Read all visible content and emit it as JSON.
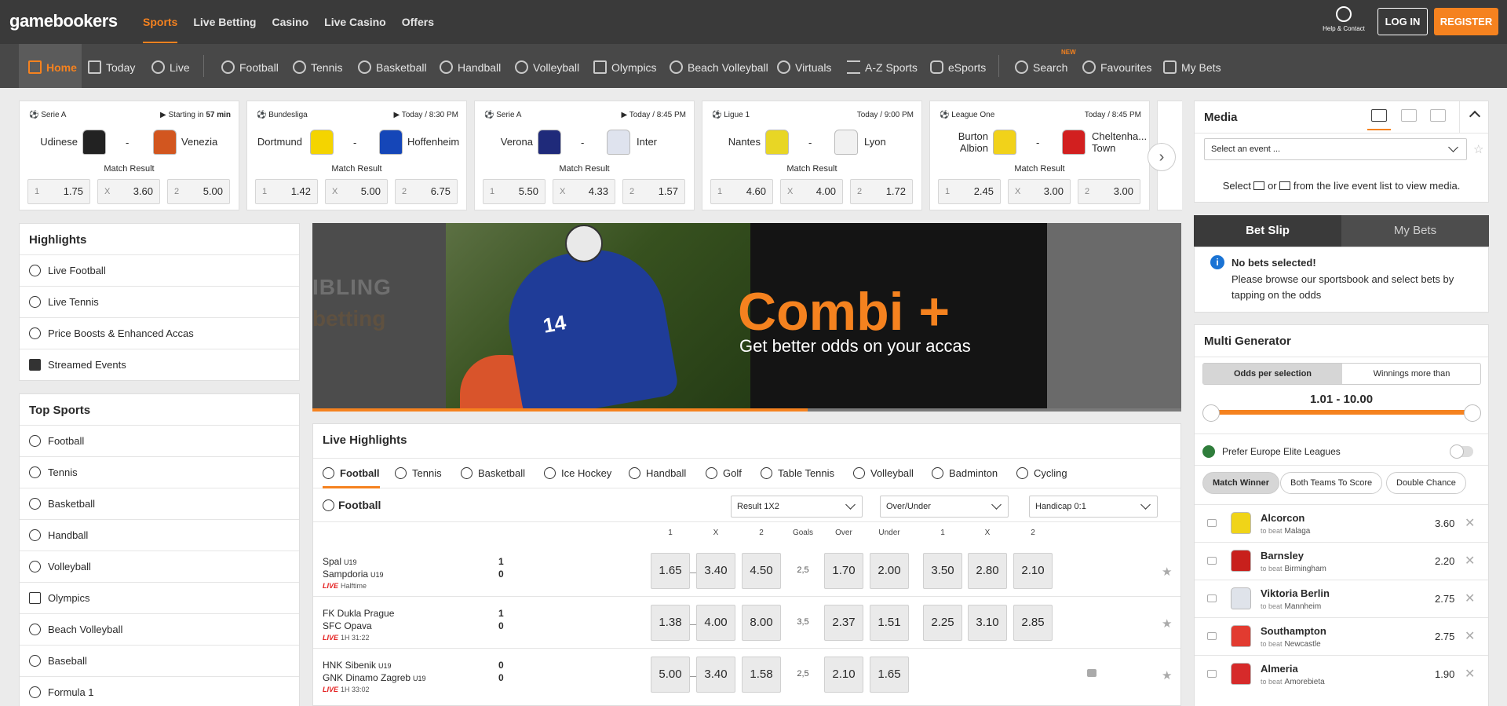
{
  "brand": "gamebookers",
  "top_nav": [
    "Sports",
    "Live Betting",
    "Casino",
    "Live Casino",
    "Offers"
  ],
  "help": "Help & Contact",
  "login": "LOG IN",
  "register": "REGISTER",
  "sub_nav": [
    "Home",
    "Today",
    "Live",
    "Football",
    "Tennis",
    "Basketball",
    "Handball",
    "Volleyball",
    "Olympics",
    "Beach Volleyball",
    "Virtuals",
    "A-Z Sports",
    "eSports",
    "Search",
    "Favourites",
    "My Bets"
  ],
  "new_badge": "NEW",
  "events": [
    {
      "league": "Serie A",
      "time_prefix": "Starting in",
      "time": "57 min",
      "home": "Udinese",
      "away": "Venezia",
      "market": "Match Result",
      "odds": [
        "1.75",
        "3.60",
        "5.00"
      ],
      "home_color": "#222222",
      "away_color": "#d2561f"
    },
    {
      "league": "Bundesliga",
      "time_prefix": "",
      "time": "Today / 8:30 PM",
      "home": "Dortmund",
      "away": "Hoffenheim",
      "market": "Match Result",
      "odds": [
        "1.42",
        "5.00",
        "6.75"
      ],
      "home_color": "#f4d400",
      "away_color": "#1546b8"
    },
    {
      "league": "Serie A",
      "time_prefix": "",
      "time": "Today / 8:45 PM",
      "home": "Verona",
      "away": "Inter",
      "market": "Match Result",
      "odds": [
        "5.50",
        "4.33",
        "1.57"
      ],
      "home_color": "#1f2a7a",
      "away_color": "#dfe3ee"
    },
    {
      "league": "Ligue 1",
      "time_prefix": "",
      "time": "Today / 9:00 PM",
      "home": "Nantes",
      "away": "Lyon",
      "market": "Match Result",
      "odds": [
        "4.60",
        "4.00",
        "1.72"
      ],
      "home_color": "#e8d625",
      "away_color": "#f1f1f1"
    },
    {
      "league": "League One",
      "time_prefix": "",
      "time": "Today / 8:45 PM",
      "home": "Burton Albion",
      "away": "Cheltenha... Town",
      "market": "Match Result",
      "odds": [
        "2.45",
        "3.00",
        "3.00"
      ],
      "home_color": "#f1d21a",
      "away_color": "#d21f1f"
    }
  ],
  "odds_labels": [
    "1",
    "X",
    "2"
  ],
  "highlights": {
    "title": "Highlights",
    "items": [
      "Live Football",
      "Live Tennis",
      "Price Boosts & Enhanced Accas",
      "Streamed Events"
    ]
  },
  "top_sports": {
    "title": "Top Sports",
    "items": [
      "Football",
      "Tennis",
      "Basketball",
      "Handball",
      "Volleyball",
      "Olympics",
      "Beach Volleyball",
      "Baseball",
      "Formula 1"
    ]
  },
  "banner": {
    "left_line1": "IBLING",
    "left_line2": "betting",
    "headline": "Combi +",
    "sub": "Get better odds on your accas",
    "player_number": "14",
    "progress": 0.57
  },
  "live_highlights": {
    "title": "Live Highlights",
    "tabs": [
      "Football",
      "Tennis",
      "Basketball",
      "Ice Hockey",
      "Handball",
      "Golf",
      "Table Tennis",
      "Volleyball",
      "Badminton",
      "Cycling"
    ],
    "sport": "Football",
    "dropdowns": [
      "Result 1X2",
      "Over/Under",
      "Handicap 0:1"
    ],
    "columns": [
      "1",
      "X",
      "2",
      "Goals",
      "Over",
      "Under",
      "1",
      "X",
      "2"
    ],
    "matches": [
      {
        "home": "Spal",
        "home_tag": "U19",
        "away": "Sampdoria",
        "away_tag": "U19",
        "score_home": "1",
        "score_away": "0",
        "live": "LIVE",
        "status": "Halftime",
        "r1x2": [
          "1.65",
          "3.40",
          "4.50"
        ],
        "goals": "2,5",
        "ou": [
          "1.70",
          "2.00"
        ],
        "hcp": [
          "3.50",
          "2.80",
          "2.10"
        ]
      },
      {
        "home": "FK Dukla Prague",
        "home_tag": "",
        "away": "SFC Opava",
        "away_tag": "",
        "score_home": "1",
        "score_away": "0",
        "live": "LIVE",
        "status": "1H 31:22",
        "r1x2": [
          "1.38",
          "4.00",
          "8.00"
        ],
        "goals": "3,5",
        "ou": [
          "2.37",
          "1.51"
        ],
        "hcp": [
          "2.25",
          "3.10",
          "2.85"
        ]
      },
      {
        "home": "HNK Sibenik",
        "home_tag": "U19",
        "away": "GNK Dinamo Zagreb",
        "away_tag": "U19",
        "score_home": "0",
        "score_away": "0",
        "live": "LIVE",
        "status": "1H 33:02",
        "r1x2": [
          "5.00",
          "3.40",
          "1.58"
        ],
        "goals": "2,5",
        "ou": [
          "2.10",
          "1.65"
        ],
        "hcp": []
      }
    ]
  },
  "media": {
    "title": "Media",
    "select_placeholder": "Select an event ...",
    "hint_a": "Select",
    "hint_or": "or",
    "hint_b": "from the live event list to view media."
  },
  "betslip": {
    "tab_active": "Bet Slip",
    "tab_other": "My Bets",
    "empty_title": "No bets selected!",
    "empty_text": "Please browse our sportsbook and select bets by tapping on the odds"
  },
  "multi": {
    "title": "Multi Generator",
    "toggle": [
      "Odds per selection",
      "Winnings more than"
    ],
    "range": "1.01 - 10.00",
    "prefer": "Prefer Europe Elite Leagues",
    "chips": [
      "Match Winner",
      "Both Teams To Score",
      "Double Chance"
    ],
    "to_beat": "to beat",
    "rows": [
      {
        "team": "Alcorcon",
        "beat": "Malaga",
        "odd": "3.60",
        "color": "#f0d418"
      },
      {
        "team": "Barnsley",
        "beat": "Birmingham",
        "odd": "2.20",
        "color": "#c8201c"
      },
      {
        "team": "Viktoria Berlin",
        "beat": "Mannheim",
        "odd": "2.75",
        "color": "#dfe3ea"
      },
      {
        "team": "Southampton",
        "beat": "Newcastle",
        "odd": "2.75",
        "color": "#e23b30"
      },
      {
        "team": "Almeria",
        "beat": "Amorebieta",
        "odd": "1.90",
        "color": "#d62a2a"
      }
    ]
  }
}
